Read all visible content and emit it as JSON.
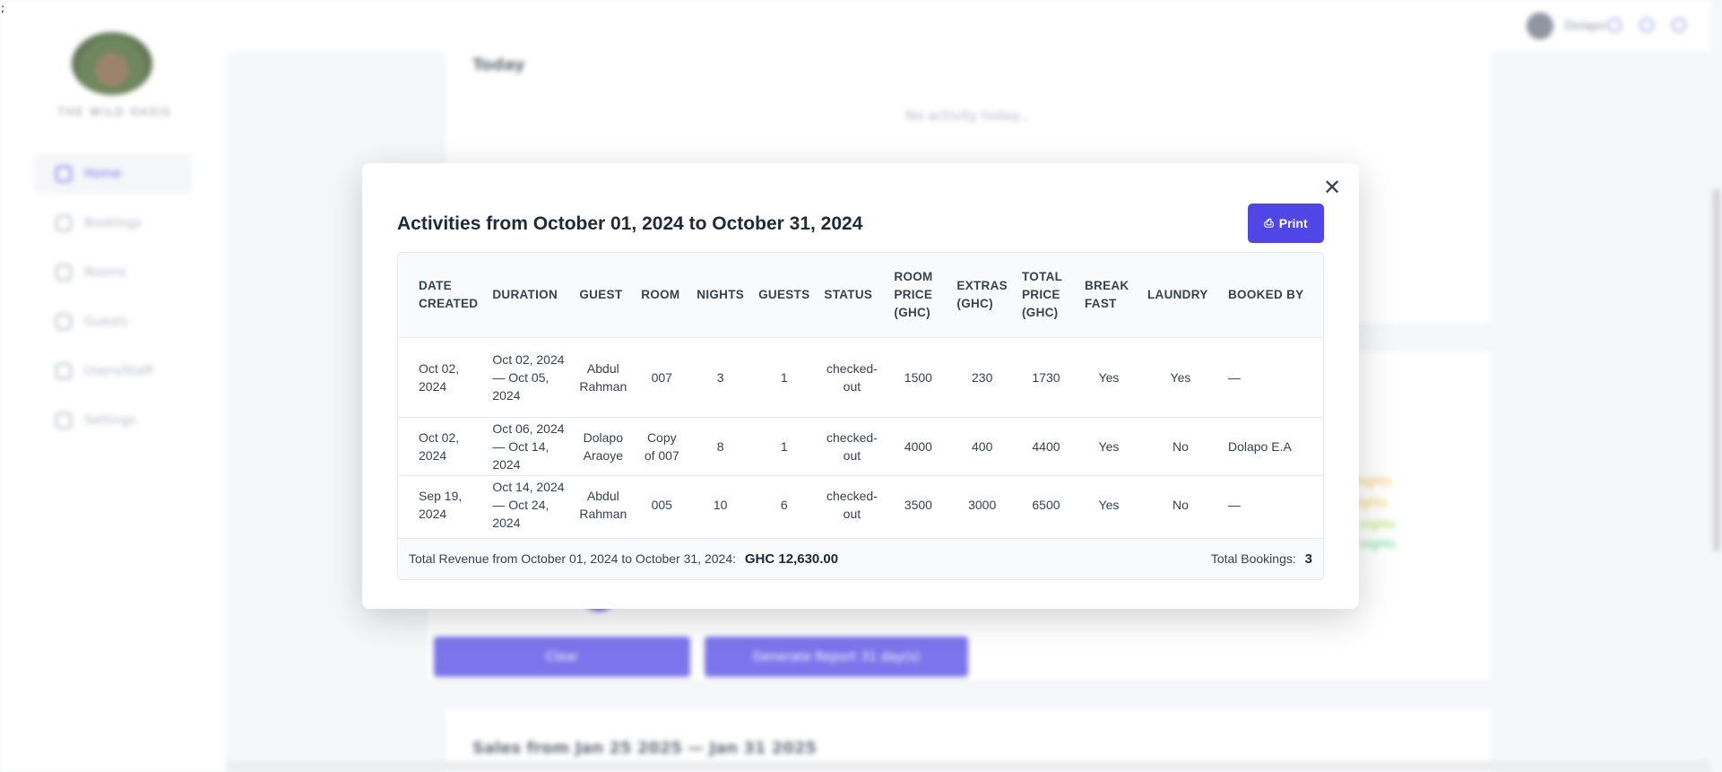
{
  "stray_char": ";",
  "sidebar": {
    "logo_text": "THE WILD OASIS",
    "items": [
      {
        "label": "Home",
        "icon": "home-icon",
        "active": true
      },
      {
        "label": "Bookings",
        "icon": "calendar-icon"
      },
      {
        "label": "Rooms",
        "icon": "rooms-icon"
      },
      {
        "label": "Guests",
        "icon": "guests-icon"
      },
      {
        "label": "Users/Staff",
        "icon": "users-icon"
      },
      {
        "label": "Settings",
        "icon": "settings-icon"
      }
    ]
  },
  "header": {
    "user_name": "Dolapo",
    "icons": [
      "user-icon",
      "moon-icon",
      "logout-icon"
    ]
  },
  "background": {
    "today_title": "Today",
    "no_activity": "No activity today...",
    "clear_label": "Clear",
    "generate_label": "Generate Report 31 day(s)",
    "sales_title": "Sales from Jan 25 2025 — Jan 31 2025",
    "legend": [
      "nights",
      "nights",
      "nights",
      "nights"
    ]
  },
  "modal": {
    "title": "Activities from October 01, 2024 to October 31, 2024",
    "print_label": "Print",
    "columns": [
      "DATE CREATED",
      "DURATION",
      "GUEST",
      "ROOM",
      "NIGHTS",
      "GUESTS",
      "STATUS",
      "ROOM PRICE (GHC)",
      "EXTRAS (GHC)",
      "TOTAL PRICE (GHC)",
      "BREAK FAST",
      "LAUNDRY",
      "BOOKED BY"
    ],
    "rows": [
      {
        "date_created": "Oct 02, 2024",
        "duration": "Oct 02, 2024 — Oct 05, 2024",
        "guest": "Abdul Rahman",
        "room": "007",
        "nights": "3",
        "guests": "1",
        "status": "checked-out",
        "room_price": "1500",
        "extras": "230",
        "total_price": "1730",
        "breakfast": "Yes",
        "laundry": "Yes",
        "booked_by": "—"
      },
      {
        "date_created": "Oct 02, 2024",
        "duration": "Oct 06, 2024 — Oct 14, 2024",
        "guest": "Dolapo Araoye",
        "room": "Copy of 007",
        "nights": "8",
        "guests": "1",
        "status": "checked-out",
        "room_price": "4000",
        "extras": "400",
        "total_price": "4400",
        "breakfast": "Yes",
        "laundry": "No",
        "booked_by": "Dolapo E.A"
      },
      {
        "date_created": "Sep 19, 2024",
        "duration": "Oct 14, 2024 — Oct 24, 2024",
        "guest": "Abdul Rahman",
        "room": "005",
        "nights": "10",
        "guests": "6",
        "status": "checked-out",
        "room_price": "3500",
        "extras": "3000",
        "total_price": "6500",
        "breakfast": "Yes",
        "laundry": "No",
        "booked_by": "—"
      }
    ],
    "summary": {
      "revenue_label": "Total Revenue from October 01, 2024 to October 31, 2024:",
      "revenue_value": "GHC 12,630.00",
      "bookings_label": "Total Bookings:",
      "bookings_value": "3"
    }
  }
}
